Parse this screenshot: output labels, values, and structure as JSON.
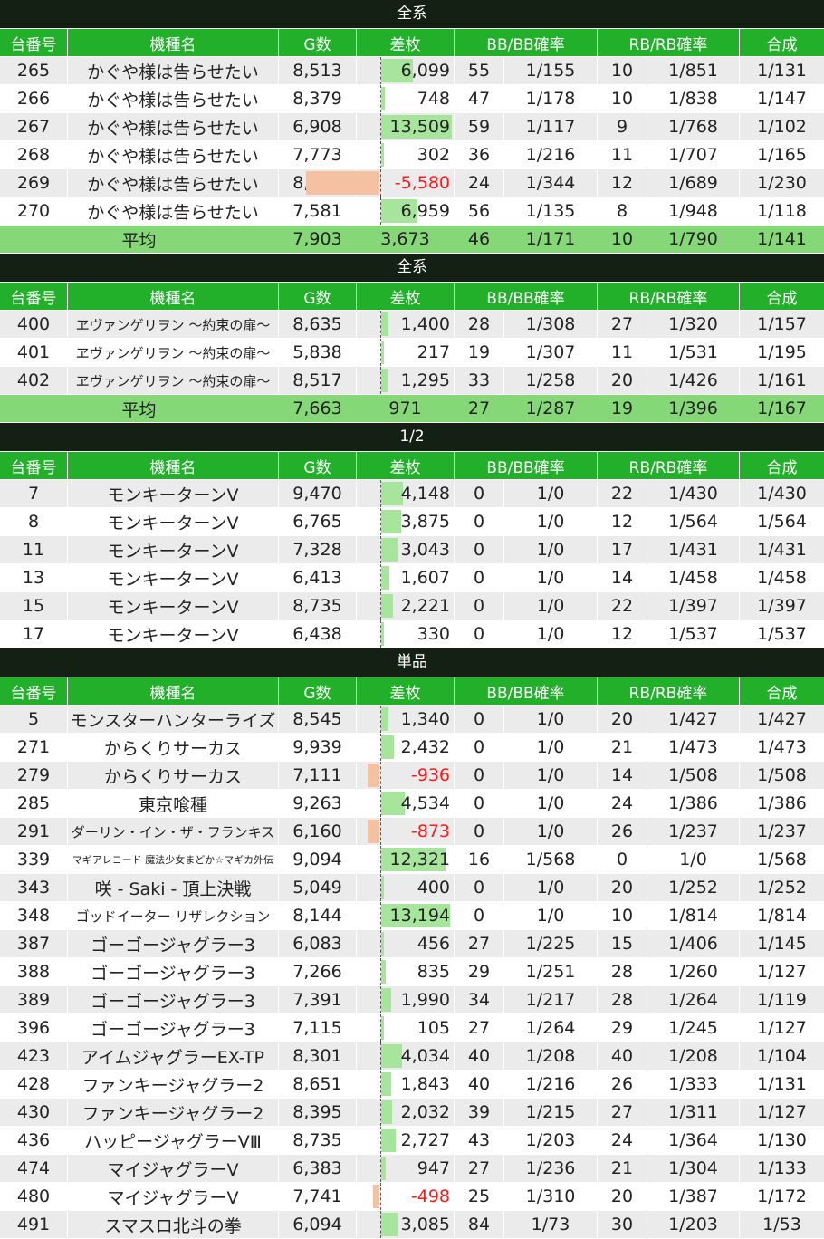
{
  "headers": {
    "no": "台番号",
    "name": "機種名",
    "games": "G数",
    "diff": "差枚",
    "bb": "BB/BB確率",
    "rb": "RB/RB確率",
    "synth": "合成"
  },
  "avg_label": "平均",
  "colors": {
    "header_bg": "#22b02b",
    "title_bg": "#132013",
    "avg_bg": "#86d778",
    "positive_bar": "#a7e59d",
    "negative_bar": "#f4c2a3",
    "negative_text": "#ff1a1a"
  },
  "sections": [
    {
      "title": "全系",
      "rows": [
        {
          "no": "265",
          "name": "かぐや様は告らせたい",
          "games": "8,513",
          "diff": "6,099",
          "diff_num": 6099,
          "bb": "55",
          "bbp": "1/155",
          "rb": "10",
          "rbp": "1/851",
          "synth": "1/131"
        },
        {
          "no": "266",
          "name": "かぐや様は告らせたい",
          "games": "8,379",
          "diff": "748",
          "diff_num": 748,
          "bb": "47",
          "bbp": "1/178",
          "rb": "10",
          "rbp": "1/838",
          "synth": "1/147"
        },
        {
          "no": "267",
          "name": "かぐや様は告らせたい",
          "games": "6,908",
          "diff": "13,509",
          "diff_num": 13509,
          "bb": "59",
          "bbp": "1/117",
          "rb": "9",
          "rbp": "1/768",
          "synth": "1/102"
        },
        {
          "no": "268",
          "name": "かぐや様は告らせたい",
          "games": "7,773",
          "diff": "302",
          "diff_num": 302,
          "bb": "36",
          "bbp": "1/216",
          "rb": "11",
          "rbp": "1/707",
          "synth": "1/165"
        },
        {
          "no": "269",
          "name": "かぐや様は告らせたい",
          "games": "8,262",
          "diff": "-5,580",
          "diff_num": -5580,
          "bb": "24",
          "bbp": "1/344",
          "rb": "12",
          "rbp": "1/689",
          "synth": "1/230"
        },
        {
          "no": "270",
          "name": "かぐや様は告らせたい",
          "games": "7,581",
          "diff": "6,959",
          "diff_num": 6959,
          "bb": "56",
          "bbp": "1/135",
          "rb": "8",
          "rbp": "1/948",
          "synth": "1/118"
        }
      ],
      "avg": {
        "games": "7,903",
        "diff": "3,673",
        "bb": "46",
        "bbp": "1/171",
        "rb": "10",
        "rbp": "1/790",
        "synth": "1/141"
      }
    },
    {
      "title": "全系",
      "rows": [
        {
          "no": "400",
          "name": "ヱヴァンゲリヲン ～約束の扉～",
          "small": true,
          "games": "8,635",
          "diff": "1,400",
          "diff_num": 1400,
          "bb": "28",
          "bbp": "1/308",
          "rb": "27",
          "rbp": "1/320",
          "synth": "1/157"
        },
        {
          "no": "401",
          "name": "ヱヴァンゲリヲン ～約束の扉～",
          "small": true,
          "games": "5,838",
          "diff": "217",
          "diff_num": 217,
          "bb": "19",
          "bbp": "1/307",
          "rb": "11",
          "rbp": "1/531",
          "synth": "1/195"
        },
        {
          "no": "402",
          "name": "ヱヴァンゲリヲン ～約束の扉～",
          "small": true,
          "games": "8,517",
          "diff": "1,295",
          "diff_num": 1295,
          "bb": "33",
          "bbp": "1/258",
          "rb": "20",
          "rbp": "1/426",
          "synth": "1/161"
        }
      ],
      "avg": {
        "games": "7,663",
        "diff": "971",
        "bb": "27",
        "bbp": "1/287",
        "rb": "19",
        "rbp": "1/396",
        "synth": "1/167"
      }
    },
    {
      "title": "1/2",
      "rows": [
        {
          "no": "7",
          "name": "モンキーターンV",
          "games": "9,470",
          "diff": "4,148",
          "diff_num": 4148,
          "bb": "0",
          "bbp": "1/0",
          "rb": "22",
          "rbp": "1/430",
          "synth": "1/430"
        },
        {
          "no": "8",
          "name": "モンキーターンV",
          "games": "6,765",
          "diff": "3,875",
          "diff_num": 3875,
          "bb": "0",
          "bbp": "1/0",
          "rb": "12",
          "rbp": "1/564",
          "synth": "1/564"
        },
        {
          "no": "11",
          "name": "モンキーターンV",
          "games": "7,328",
          "diff": "3,043",
          "diff_num": 3043,
          "bb": "0",
          "bbp": "1/0",
          "rb": "17",
          "rbp": "1/431",
          "synth": "1/431"
        },
        {
          "no": "13",
          "name": "モンキーターンV",
          "games": "6,413",
          "diff": "1,607",
          "diff_num": 1607,
          "bb": "0",
          "bbp": "1/0",
          "rb": "14",
          "rbp": "1/458",
          "synth": "1/458"
        },
        {
          "no": "15",
          "name": "モンキーターンV",
          "games": "8,735",
          "diff": "2,221",
          "diff_num": 2221,
          "bb": "0",
          "bbp": "1/0",
          "rb": "22",
          "rbp": "1/397",
          "synth": "1/397"
        },
        {
          "no": "17",
          "name": "モンキーターンV",
          "games": "6,438",
          "diff": "330",
          "diff_num": 330,
          "bb": "0",
          "bbp": "1/0",
          "rb": "12",
          "rbp": "1/537",
          "synth": "1/537"
        }
      ]
    },
    {
      "title": "単品",
      "rows": [
        {
          "no": "5",
          "name": "モンスターハンターライズ",
          "games": "8,545",
          "diff": "1,340",
          "diff_num": 1340,
          "bb": "0",
          "bbp": "1/0",
          "rb": "20",
          "rbp": "1/427",
          "synth": "1/427"
        },
        {
          "no": "271",
          "name": "からくりサーカス",
          "games": "9,939",
          "diff": "2,432",
          "diff_num": 2432,
          "bb": "0",
          "bbp": "1/0",
          "rb": "21",
          "rbp": "1/473",
          "synth": "1/473"
        },
        {
          "no": "279",
          "name": "からくりサーカス",
          "games": "7,111",
          "diff": "-936",
          "diff_num": -936,
          "bb": "0",
          "bbp": "1/0",
          "rb": "14",
          "rbp": "1/508",
          "synth": "1/508"
        },
        {
          "no": "285",
          "name": "東京喰種",
          "games": "9,263",
          "diff": "4,534",
          "diff_num": 4534,
          "bb": "0",
          "bbp": "1/0",
          "rb": "24",
          "rbp": "1/386",
          "synth": "1/386"
        },
        {
          "no": "291",
          "name": "ダーリン・イン・ザ・フランキス",
          "small": true,
          "games": "6,160",
          "diff": "-873",
          "diff_num": -873,
          "bb": "0",
          "bbp": "1/0",
          "rb": "26",
          "rbp": "1/237",
          "synth": "1/237"
        },
        {
          "no": "339",
          "name": "マギアレコード 魔法少女まどか☆マギカ外伝",
          "tiny": true,
          "games": "9,094",
          "diff": "12,321",
          "diff_num": 12321,
          "bb": "16",
          "bbp": "1/568",
          "rb": "0",
          "rbp": "1/0",
          "synth": "1/568"
        },
        {
          "no": "343",
          "name": "咲 - Saki -  頂上決戦",
          "games": "5,049",
          "diff": "400",
          "diff_num": 400,
          "bb": "0",
          "bbp": "1/0",
          "rb": "20",
          "rbp": "1/252",
          "synth": "1/252"
        },
        {
          "no": "348",
          "name": "ゴッドイーター リザレクション",
          "small": true,
          "games": "8,144",
          "diff": "13,194",
          "diff_num": 13194,
          "bb": "0",
          "bbp": "1/0",
          "rb": "10",
          "rbp": "1/814",
          "synth": "1/814"
        },
        {
          "no": "387",
          "name": "ゴーゴージャグラー3",
          "games": "6,083",
          "diff": "456",
          "diff_num": 456,
          "bb": "27",
          "bbp": "1/225",
          "rb": "15",
          "rbp": "1/406",
          "synth": "1/145"
        },
        {
          "no": "388",
          "name": "ゴーゴージャグラー3",
          "games": "7,266",
          "diff": "835",
          "diff_num": 835,
          "bb": "29",
          "bbp": "1/251",
          "rb": "28",
          "rbp": "1/260",
          "synth": "1/127"
        },
        {
          "no": "389",
          "name": "ゴーゴージャグラー3",
          "games": "7,391",
          "diff": "1,990",
          "diff_num": 1990,
          "bb": "34",
          "bbp": "1/217",
          "rb": "28",
          "rbp": "1/264",
          "synth": "1/119"
        },
        {
          "no": "396",
          "name": "ゴーゴージャグラー3",
          "games": "7,115",
          "diff": "105",
          "diff_num": 105,
          "bb": "27",
          "bbp": "1/264",
          "rb": "29",
          "rbp": "1/245",
          "synth": "1/127"
        },
        {
          "no": "423",
          "name": "アイムジャグラーEX-TP",
          "games": "8,301",
          "diff": "4,034",
          "diff_num": 4034,
          "bb": "40",
          "bbp": "1/208",
          "rb": "40",
          "rbp": "1/208",
          "synth": "1/104"
        },
        {
          "no": "428",
          "name": "ファンキージャグラー2",
          "games": "8,651",
          "diff": "1,843",
          "diff_num": 1843,
          "bb": "40",
          "bbp": "1/216",
          "rb": "26",
          "rbp": "1/333",
          "synth": "1/131"
        },
        {
          "no": "430",
          "name": "ファンキージャグラー2",
          "games": "8,395",
          "diff": "2,032",
          "diff_num": 2032,
          "bb": "39",
          "bbp": "1/215",
          "rb": "27",
          "rbp": "1/311",
          "synth": "1/127"
        },
        {
          "no": "436",
          "name": "ハッピージャグラーVⅢ",
          "games": "8,735",
          "diff": "2,727",
          "diff_num": 2727,
          "bb": "43",
          "bbp": "1/203",
          "rb": "24",
          "rbp": "1/364",
          "synth": "1/130"
        },
        {
          "no": "474",
          "name": "マイジャグラーV",
          "games": "6,383",
          "diff": "947",
          "diff_num": 947,
          "bb": "27",
          "bbp": "1/236",
          "rb": "21",
          "rbp": "1/304",
          "synth": "1/133"
        },
        {
          "no": "480",
          "name": "マイジャグラーV",
          "games": "7,741",
          "diff": "-498",
          "diff_num": -498,
          "bb": "25",
          "bbp": "1/310",
          "rb": "20",
          "rbp": "1/387",
          "synth": "1/172"
        },
        {
          "no": "491",
          "name": "スマスロ北斗の拳",
          "games": "6,094",
          "diff": "3,085",
          "diff_num": 3085,
          "bb": "84",
          "bbp": "1/73",
          "rb": "30",
          "rbp": "1/203",
          "synth": "1/53"
        }
      ]
    }
  ]
}
